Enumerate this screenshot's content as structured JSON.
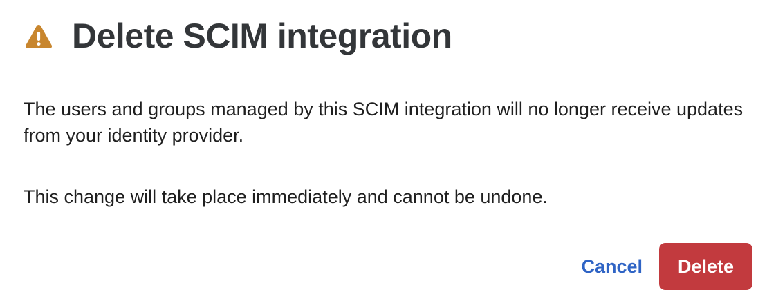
{
  "dialog": {
    "title": "Delete SCIM integration",
    "icon": "warning-icon",
    "paragraphs": [
      "The users and groups managed by this SCIM integration will no longer receive updates from your identity provider.",
      "This change will take place immediately and cannot be undone."
    ],
    "actions": {
      "cancel_label": "Cancel",
      "delete_label": "Delete"
    }
  },
  "colors": {
    "warning": "#c8862e",
    "title": "#333639",
    "link_blue": "#2f64c5",
    "danger": "#c23a3e"
  }
}
